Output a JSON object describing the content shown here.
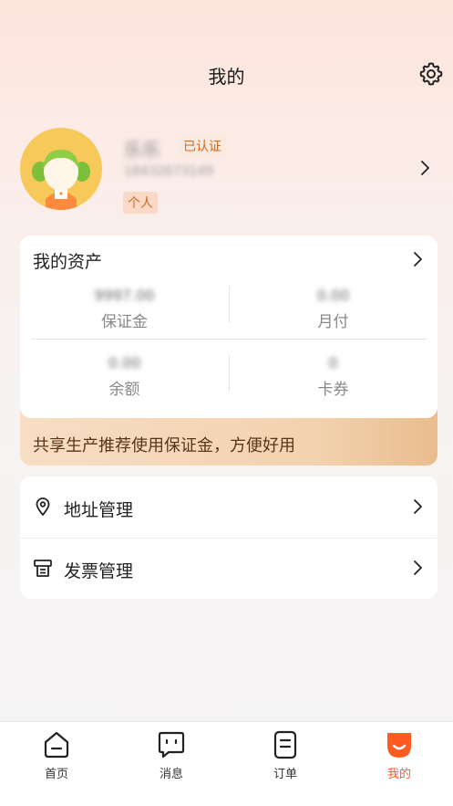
{
  "header": {
    "title": "我的"
  },
  "profile": {
    "name": "乐乐",
    "verified_badge": "已认证",
    "phone": "18432673149",
    "account_type": "个人"
  },
  "assets": {
    "title": "我的资产",
    "items": [
      {
        "value": "9997.00",
        "label": "保证金"
      },
      {
        "value": "0.00",
        "label": "月付"
      },
      {
        "value": "0.00",
        "label": "余额"
      },
      {
        "value": "0",
        "label": "卡券"
      }
    ],
    "promo": "共享生产推荐使用保证金，方便好用"
  },
  "menu": [
    {
      "label": "地址管理",
      "icon": "location-pin-icon"
    },
    {
      "label": "发票管理",
      "icon": "invoice-icon"
    }
  ],
  "tabbar": {
    "tabs": [
      {
        "label": "首页",
        "icon": "home-icon"
      },
      {
        "label": "消息",
        "icon": "message-icon"
      },
      {
        "label": "订单",
        "icon": "order-icon"
      },
      {
        "label": "我的",
        "icon": "profile-icon",
        "active": true
      }
    ],
    "active_color": "#ff5a1f"
  }
}
